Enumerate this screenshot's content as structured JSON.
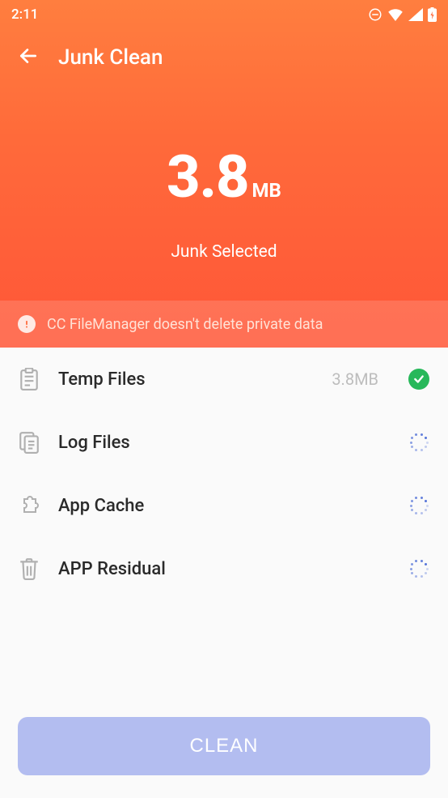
{
  "status_bar": {
    "time": "2:11"
  },
  "app_bar": {
    "title": "Junk Clean"
  },
  "hero": {
    "size_value": "3.8",
    "size_unit": "MB",
    "subtitle": "Junk Selected"
  },
  "notice": {
    "text": "CC FileManager doesn't delete private data"
  },
  "categories": [
    {
      "label": "Temp Files",
      "size": "3.8MB",
      "state": "done"
    },
    {
      "label": "Log Files",
      "size": "",
      "state": "loading"
    },
    {
      "label": "App Cache",
      "size": "",
      "state": "loading"
    },
    {
      "label": "APP Residual",
      "size": "",
      "state": "loading"
    }
  ],
  "clean_button": {
    "label": "CLEAN"
  }
}
